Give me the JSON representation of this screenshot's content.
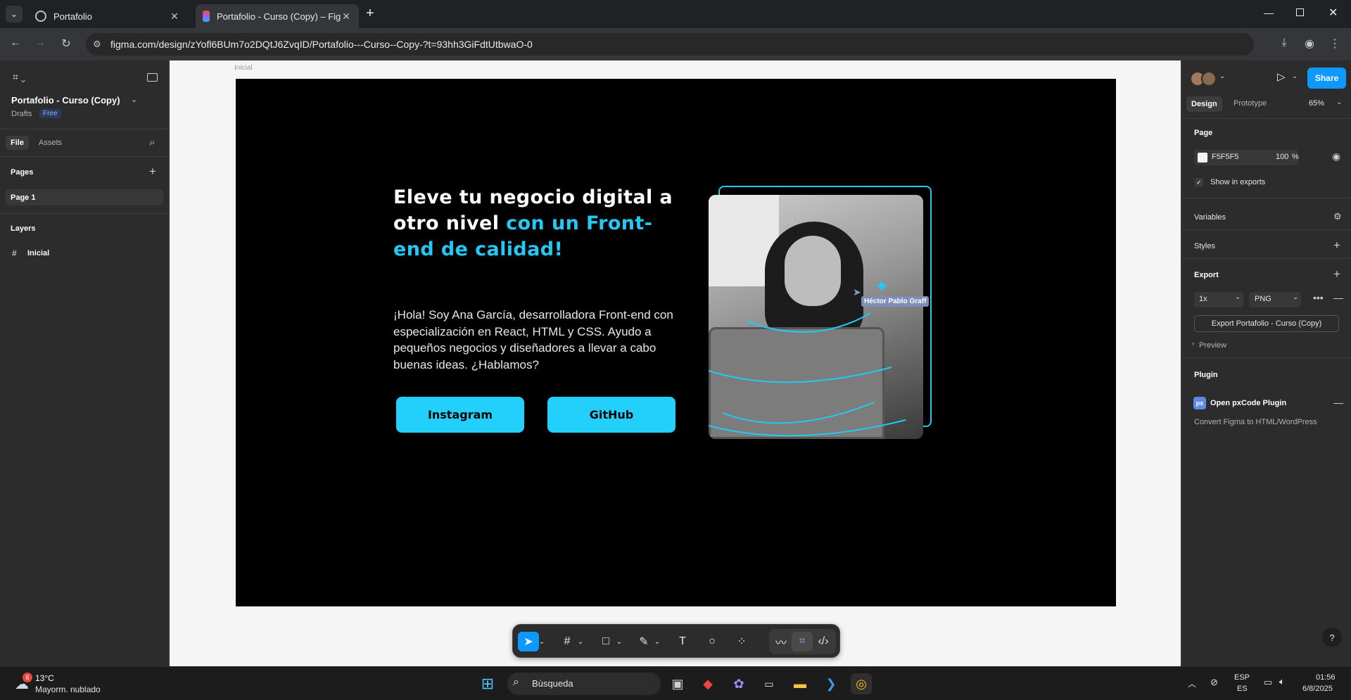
{
  "browser": {
    "tabs": [
      {
        "title": "Portafolio",
        "active": false
      },
      {
        "title": "Portafolio - Curso (Copy) – Figm",
        "active": true
      }
    ],
    "url": "figma.com/design/zYofl6BUm7o2DQtJ6ZvqID/Portafolio---Curso--Copy-?t=93hh3GiFdtUtbwaO-0"
  },
  "figma": {
    "file_name": "Portafolio - Curso (Copy)",
    "drafts_label": "Drafts",
    "plan_badge": "Free",
    "left_tabs": [
      "File",
      "Assets"
    ],
    "pages_heading": "Pages",
    "pages": [
      "Page 1"
    ],
    "layers_heading": "Layers",
    "layers": [
      "Inicial"
    ],
    "frame_label": "Inicial"
  },
  "design": {
    "heading_part1": "Eleve tu negocio digital a otro nivel ",
    "heading_accent": "con un Front-end de calidad!",
    "paragraph": "¡Hola! Soy Ana García, desarrolladora Front-end con especialización en React, HTML y CSS. Ayudo a pequeños negocios y diseñadores a llevar a cabo buenas ideas. ¿Hablamos?",
    "buttons": [
      "Instagram",
      "GitHub"
    ],
    "cursor_label": "Héctor Pablo Graff",
    "accent_color": "#22d0fb"
  },
  "right_panel": {
    "share_label": "Share",
    "tabs": [
      "Design",
      "Prototype"
    ],
    "zoom": "65%",
    "page_heading": "Page",
    "page_color": "F5F5F5",
    "page_opacity": "100",
    "percent_sign": "%",
    "show_in_exports": "Show in exports",
    "variables": "Variables",
    "styles": "Styles",
    "export": "Export",
    "export_scale": "1x",
    "export_format": "PNG",
    "export_button": "Export Portafolio - Curso (Copy)",
    "preview": "Preview",
    "plugin_heading": "Plugin",
    "plugin_badge": "px",
    "plugin_name": "Open pxCode Plugin",
    "plugin_desc": "Convert Figma to HTML/WordPress",
    "help": "?"
  },
  "taskbar": {
    "weather_temp": "13°C",
    "weather_desc": "Mayorm. nublado",
    "weather_badge": "6",
    "search_label": "Búsqueda",
    "lang_top": "ESP",
    "lang_bottom": "ES",
    "time": "01:56",
    "date": "6/8/2025"
  }
}
